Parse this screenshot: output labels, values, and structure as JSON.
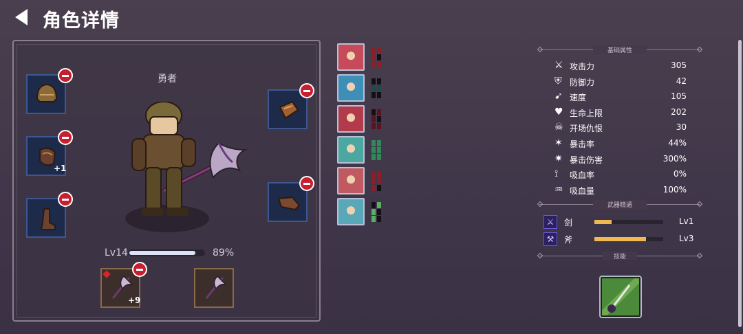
{
  "header": {
    "title": "角色详情",
    "back_icon": "back-arrow-icon"
  },
  "hero": {
    "name": "勇者",
    "level_label": "Lv14",
    "xp_percent_text": "89%",
    "xp_fraction": 0.89
  },
  "equipment": {
    "left_slots": [
      {
        "item": "helmet",
        "bonus": ""
      },
      {
        "item": "shoulder",
        "bonus": "+1"
      },
      {
        "item": "boots",
        "bonus": ""
      }
    ],
    "right_slots": [
      {
        "item": "gauntlet",
        "bonus": ""
      },
      {
        "item": "bracer",
        "bonus": ""
      }
    ],
    "weapons": [
      {
        "item": "battle-axe",
        "bonus": "+9",
        "equipped": true
      },
      {
        "item": "battle-axe",
        "bonus": "",
        "equipped": false
      }
    ]
  },
  "skills_column": [
    {
      "name": "rage-portrait",
      "color": "#c64a5a",
      "bar_color": "#8a1f2a"
    },
    {
      "name": "blade-storm-portrait",
      "color": "#3e8fb8",
      "bar_color": "#1e4a4a"
    },
    {
      "name": "maw-portrait",
      "color": "#b33a4a",
      "bar_color": "#5a1420"
    },
    {
      "name": "bear-portrait",
      "color": "#4aa8a0",
      "bar_color": "#2e8a58"
    },
    {
      "name": "archer-portrait",
      "color": "#c05a60",
      "bar_color": "#8a1f2a"
    },
    {
      "name": "priestess-portrait",
      "color": "#58a8b8",
      "bar_color": "#58b060"
    }
  ],
  "attributes": {
    "section_title": "基础属性",
    "stats": [
      {
        "icon": "sword-icon",
        "label": "攻击力",
        "value": "305"
      },
      {
        "icon": "shield-icon",
        "label": "防御力",
        "value": "42"
      },
      {
        "icon": "boot-icon",
        "label": "速度",
        "value": "105"
      },
      {
        "icon": "heart-icon",
        "label": "生命上限",
        "value": "202"
      },
      {
        "icon": "skull-icon",
        "label": "开场仇恨",
        "value": "30"
      },
      {
        "icon": "crit-icon",
        "label": "暴击率",
        "value": "44%"
      },
      {
        "icon": "crit-damage-icon",
        "label": "暴击伤害",
        "value": "300%"
      },
      {
        "icon": "fang-icon",
        "label": "吸血率",
        "value": "0%"
      },
      {
        "icon": "jaw-icon",
        "label": "吸血量",
        "value": "100%"
      }
    ]
  },
  "mastery": {
    "section_title": "武器精通",
    "items": [
      {
        "icon": "sword-mastery-icon",
        "label": "剑",
        "fraction": 0.25,
        "level": "Lv1"
      },
      {
        "icon": "axe-mastery-icon",
        "label": "斧",
        "fraction": 0.75,
        "level": "Lv3"
      }
    ]
  },
  "skills": {
    "section_title": "技能",
    "icon": "sword-skill-icon"
  }
}
